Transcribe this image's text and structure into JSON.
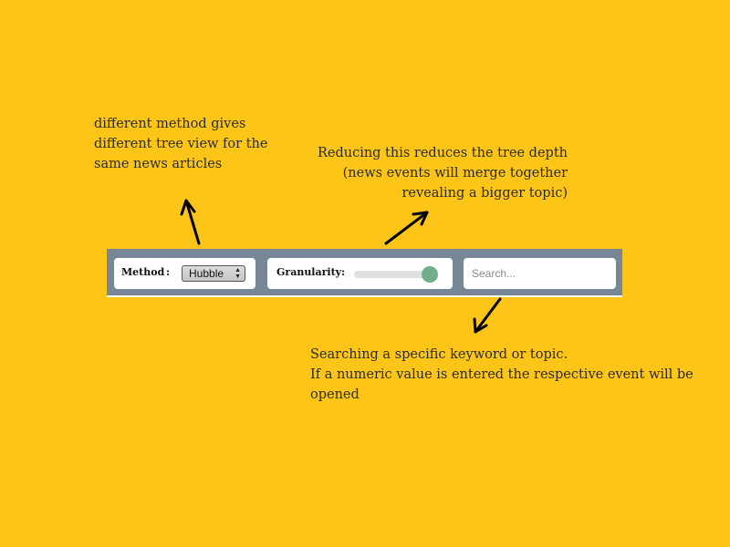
{
  "annotations": {
    "method": [
      "different method gives",
      "different tree view for the",
      "same news articles"
    ],
    "granularity": [
      "Reducing this reduces the tree depth",
      "(news events will merge together",
      "revealing a bigger topic)"
    ],
    "search": [
      "Searching a specific keyword or topic.",
      "If a numeric value is entered the respective event will be",
      "opened"
    ]
  },
  "toolbar": {
    "method": {
      "label": "Method",
      "colon": ":",
      "selected": "Hubble"
    },
    "granularity": {
      "label": "Granularity",
      "colon": ":",
      "value_fraction": 0.92
    },
    "search": {
      "placeholder": "Search..."
    }
  },
  "colors": {
    "background": "#fec519",
    "toolbar": "#778796",
    "panel": "#ffffff",
    "slider_thumb": "#73ae8c",
    "slider_track": "#e0e0e0"
  },
  "icons": {
    "select_arrows": "up-down-chevrons-icon"
  }
}
